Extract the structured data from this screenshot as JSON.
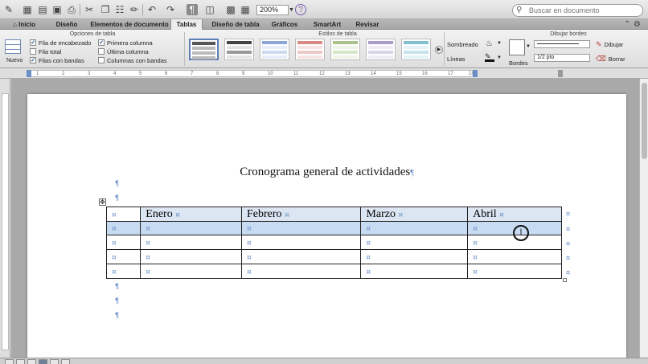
{
  "toolbar": {
    "zoom_value": "200%",
    "search_placeholder": "Buscar en documento",
    "icons": [
      "new-document-icon",
      "template-gallery-icon",
      "open-icon",
      "save-icon",
      "print-icon",
      "cut-icon",
      "copy-icon",
      "paste-icon",
      "format-painter-icon",
      "undo-icon",
      "redo-icon",
      "pilcrow-icon",
      "sidebar-icon",
      "text-box-icon",
      "table-icon",
      "zoom-dropdown",
      "help-icon"
    ]
  },
  "tabs": [
    {
      "label": "Inicio",
      "icon": "home-icon"
    },
    {
      "label": "Diseño"
    },
    {
      "label": "Elementos de documento"
    },
    {
      "label": "Tablas",
      "active": true
    },
    {
      "label": "Diseño de tabla"
    },
    {
      "label": "Gráficos"
    },
    {
      "label": "SmartArt"
    },
    {
      "label": "Revisar"
    }
  ],
  "ribbon": {
    "group_table_options": "Opciones de tabla",
    "group_table_styles": "Estilos de tabla",
    "group_draw_borders": "Dibujar bordes",
    "nuevo_label": "Nuevo",
    "options": [
      {
        "label": "Fila de encabezado",
        "checked": true
      },
      {
        "label": "Fila total",
        "checked": false
      },
      {
        "label": "Filas con bandas",
        "checked": true
      },
      {
        "label": "Primera columna",
        "checked": true
      },
      {
        "label": "Última columna",
        "checked": false
      },
      {
        "label": "Columnas con bandas",
        "checked": false
      }
    ],
    "sombreado_label": "Sombreado",
    "lineas_label": "Líneas",
    "bordes_label": "Bordes",
    "line_weight": "1/2 pto",
    "dibujar_label": "Dibujar",
    "borrar_label": "Borrar"
  },
  "ruler": {
    "ticks": [
      "1",
      "2",
      "3",
      "4",
      "5",
      "6",
      "7",
      "8",
      "9",
      "10",
      "11",
      "12",
      "13",
      "14",
      "15",
      "16",
      "17",
      "18"
    ]
  },
  "document": {
    "title": "Cronograma general de actividades",
    "pilcrow": "¶",
    "cell_mark": "¤",
    "table": {
      "headers": [
        "",
        "Enero",
        "Febrero",
        "Marzo",
        "Abril"
      ],
      "rows": [
        [
          "",
          "",
          "",
          "",
          ""
        ],
        [
          "",
          "",
          "",
          "",
          ""
        ],
        [
          "",
          "",
          "",
          "",
          ""
        ],
        [
          "",
          "",
          "",
          "",
          ""
        ]
      ]
    }
  },
  "colors": {
    "header_fill": "#dce6f3",
    "selected_row_fill": "#c7dbf3",
    "accent": "#6a8fc7"
  }
}
